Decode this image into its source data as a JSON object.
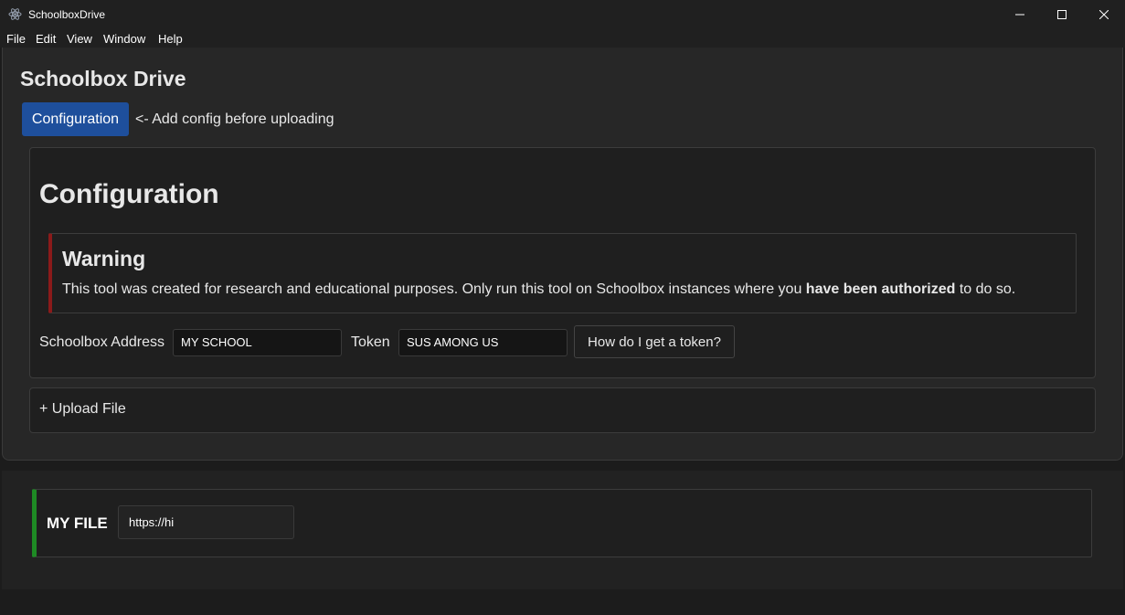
{
  "window": {
    "title": "SchoolboxDrive",
    "icon": "electron-atom-icon",
    "controls": [
      "minimize-icon",
      "maximize-icon",
      "close-icon"
    ]
  },
  "menu": [
    "File",
    "Edit",
    "View",
    "Window",
    "Help"
  ],
  "app": {
    "heading": "Schoolbox Drive",
    "config_button": "Configuration",
    "config_hint": "<- Add config before uploading"
  },
  "config": {
    "title": "Configuration",
    "warning": {
      "title": "Warning",
      "text_before": "This tool was created for research and educational purposes. Only run this tool on Schoolbox instances where you ",
      "text_bold": "have been authorized",
      "text_after": " to do so.",
      "border_color": "#8b1a1a"
    },
    "address_label": "Schoolbox Address",
    "address_value": "MY SCHOOL",
    "token_label": "Token",
    "token_value": "SUS AMONG US",
    "help_button": "How do I get a token?"
  },
  "upload": {
    "label": "+ Upload File"
  },
  "files": [
    {
      "name": "MY FILE",
      "url": "https://hi",
      "status_color": "#1e8a24"
    }
  ],
  "colors": {
    "accent": "#1e4f9c",
    "background": "#1c1c1c"
  }
}
